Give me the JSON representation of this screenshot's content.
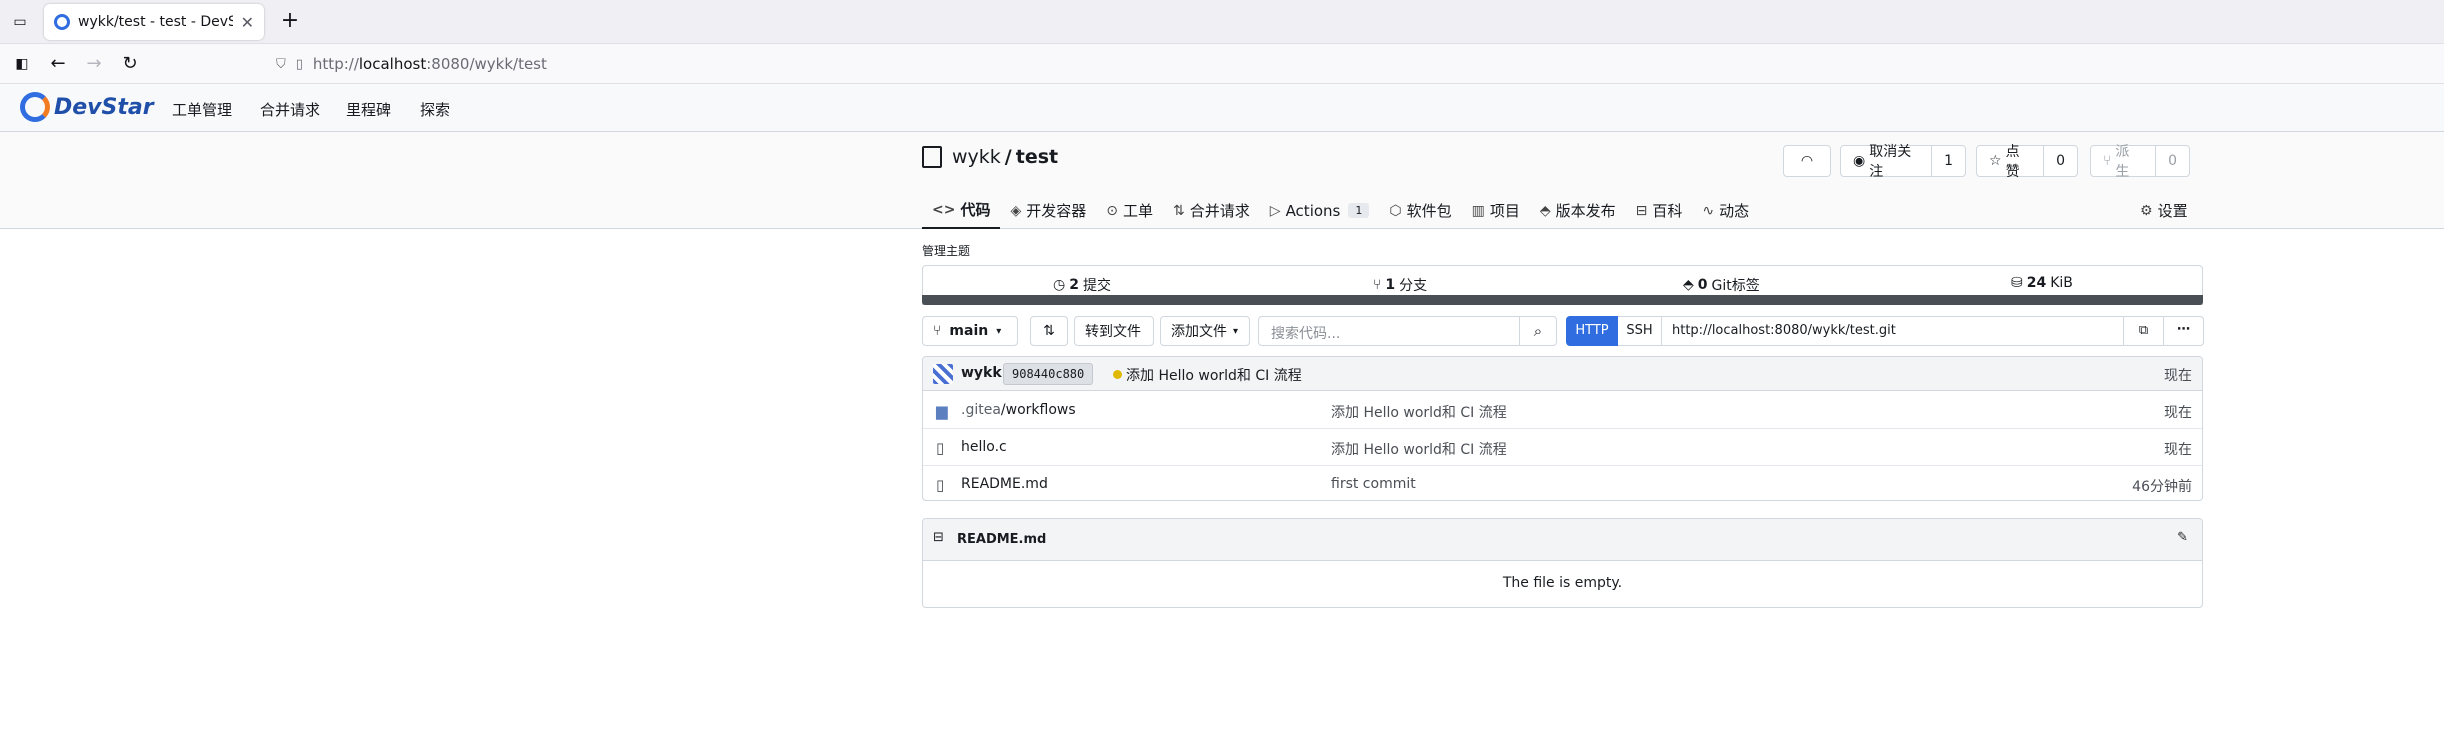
{
  "browser": {
    "tab_title": "wykk/test - test - DevStar",
    "url_prefix": "http://",
    "url_host": "localhost",
    "url_rest": ":8080/wykk/test"
  },
  "site": {
    "logo_text": "DevStar",
    "nav": [
      "工单管理",
      "合并请求",
      "里程碑",
      "探索"
    ]
  },
  "repo": {
    "owner": "wykk",
    "separator": "/",
    "name": "test",
    "unwatch_label": "取消关注",
    "watch_count": "1",
    "star_label": "点赞",
    "star_count": "0",
    "fork_label": "派生",
    "fork_count": "0",
    "tabs": [
      {
        "label": "代码",
        "icon": "code-icon"
      },
      {
        "label": "开发容器",
        "icon": "cube-icon"
      },
      {
        "label": "工单",
        "icon": "issue-icon"
      },
      {
        "label": "合并请求",
        "icon": "pull-request-icon"
      },
      {
        "label": "Actions",
        "icon": "play-icon",
        "count": "1"
      },
      {
        "label": "软件包",
        "icon": "package-icon"
      },
      {
        "label": "项目",
        "icon": "project-icon"
      },
      {
        "label": "版本发布",
        "icon": "tag-icon"
      },
      {
        "label": "百科",
        "icon": "book-icon"
      },
      {
        "label": "动态",
        "icon": "pulse-icon"
      }
    ],
    "settings_label": "设置"
  },
  "main": {
    "manage_topics": "管理主题",
    "stats": {
      "commits_count": "2",
      "commits_label": "提交",
      "branches_count": "1",
      "branches_label": "分支",
      "tags_count": "0",
      "tags_label": "Git标签",
      "size_value": "24",
      "size_unit": "KiB"
    },
    "branch": "main",
    "goto_file": "转到文件",
    "add_file": "添加文件",
    "search_placeholder": "搜索代码...",
    "clone": {
      "http": "HTTP",
      "ssh": "SSH",
      "url": "http://localhost:8080/wykk/test.git"
    },
    "latest_commit": {
      "author": "wykk",
      "sha": "908440c880",
      "message": "添加 Hello world和 CI 流程",
      "time": "现在"
    },
    "files": [
      {
        "dim": ".gitea",
        "name": "/workflows",
        "type": "folder",
        "message": "添加 Hello world和 CI 流程",
        "time": "现在"
      },
      {
        "dim": "",
        "name": "hello.c",
        "type": "file",
        "message": "添加 Hello world和 CI 流程",
        "time": "现在"
      },
      {
        "dim": "",
        "name": "README.md",
        "type": "file",
        "message": "first commit",
        "time": "46分钟前"
      }
    ],
    "readme": {
      "title": "README.md",
      "body": "The file is empty."
    }
  }
}
